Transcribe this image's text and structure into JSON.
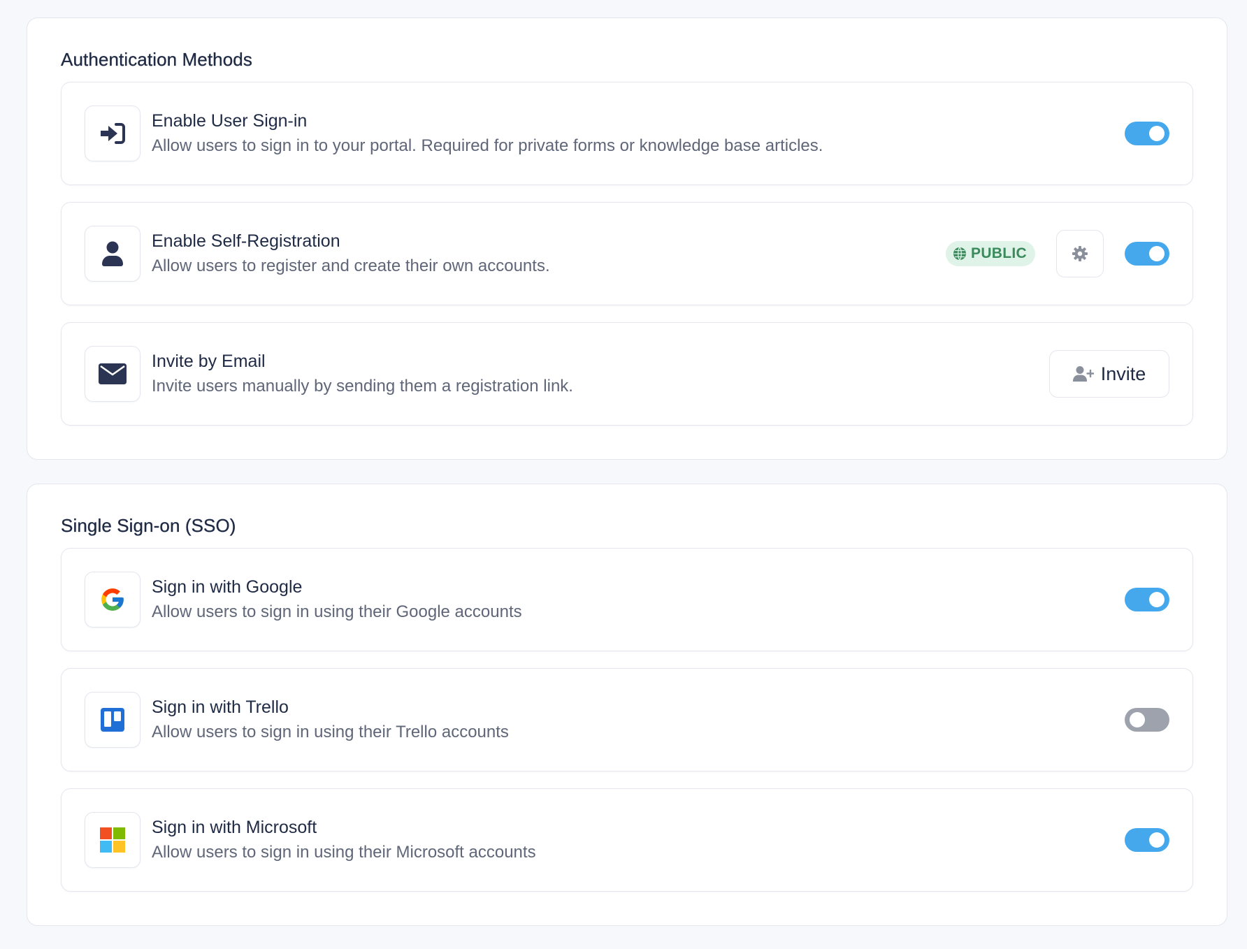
{
  "auth": {
    "title": "Authentication Methods",
    "items": [
      {
        "title": "Enable User Sign-in",
        "description": "Allow users to sign in to your portal. Required for private forms or knowledge base articles.",
        "icon": "sign-in-icon",
        "enabled": true
      },
      {
        "title": "Enable Self-Registration",
        "description": "Allow users to register and create their own accounts.",
        "icon": "user-icon",
        "badge": "PUBLIC",
        "enabled": true
      },
      {
        "title": "Invite by Email",
        "description": "Invite users manually by sending them a registration link.",
        "icon": "envelope-icon",
        "button_label": "Invite"
      }
    ]
  },
  "sso": {
    "title": "Single Sign-on (SSO)",
    "items": [
      {
        "title": "Sign in with Google",
        "description": "Allow users to sign in using their Google accounts",
        "icon": "google-logo-icon",
        "enabled": true
      },
      {
        "title": "Sign in with Trello",
        "description": "Allow users to sign in using their Trello accounts",
        "icon": "trello-logo-icon",
        "enabled": false
      },
      {
        "title": "Sign in with Microsoft",
        "description": "Allow users to sign in using their Microsoft accounts",
        "icon": "microsoft-logo-icon",
        "enabled": true
      }
    ]
  },
  "colors": {
    "toggle_on": "#46a8ec",
    "toggle_off": "#9da2ad",
    "badge_bg": "#dff3e8",
    "badge_text": "#3a8a5c",
    "text_primary": "#1f2a44",
    "text_secondary": "#5f6678"
  }
}
